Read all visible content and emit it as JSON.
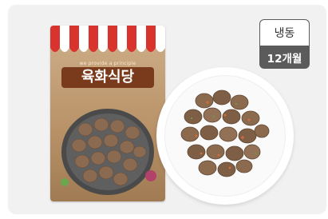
{
  "badges": {
    "storage": "냉동",
    "shelf_life": "12개월"
  },
  "package": {
    "subtitle": "we provide a principle",
    "title": "육화식당"
  },
  "colors": {
    "card_bg": "#f1f1f2",
    "badge_dark": "#5b5b5b",
    "awning_red": "#d9332e"
  }
}
